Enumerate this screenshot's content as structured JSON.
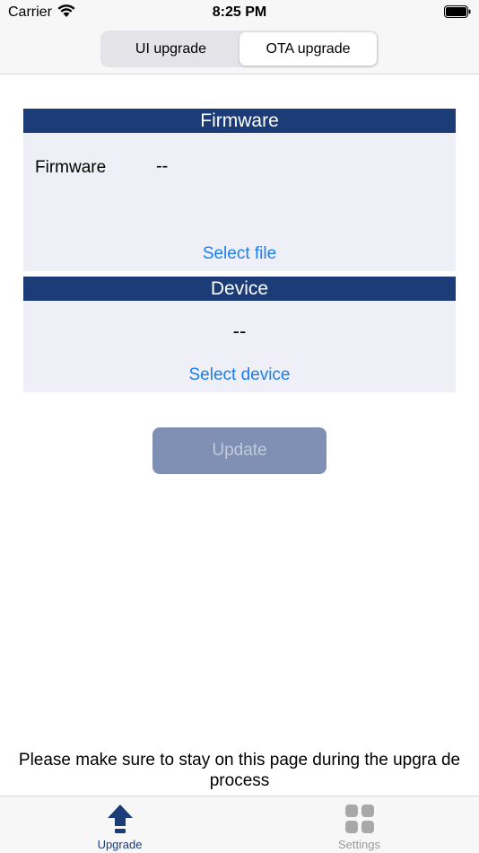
{
  "status": {
    "carrier": "Carrier",
    "time": "8:25 PM"
  },
  "segmented": {
    "items": [
      "UI upgrade",
      "OTA upgrade"
    ],
    "selected": "OTA upgrade"
  },
  "firmware": {
    "header": "Firmware",
    "label": "Firmware",
    "value": "--",
    "select_label": "Select file"
  },
  "device": {
    "header": "Device",
    "value": "--",
    "select_label": "Select device"
  },
  "update_button": "Update",
  "notice": "Please make sure to stay on this page during the upgra de process",
  "tabs": [
    {
      "label": "Upgrade",
      "icon": "upload-arrow-icon",
      "active": true
    },
    {
      "label": "Settings",
      "icon": "grid-icon",
      "active": false
    }
  ],
  "colors": {
    "accent": "#1c3c77",
    "link": "#1a7ef0",
    "button_disabled": "#7f90b4"
  }
}
